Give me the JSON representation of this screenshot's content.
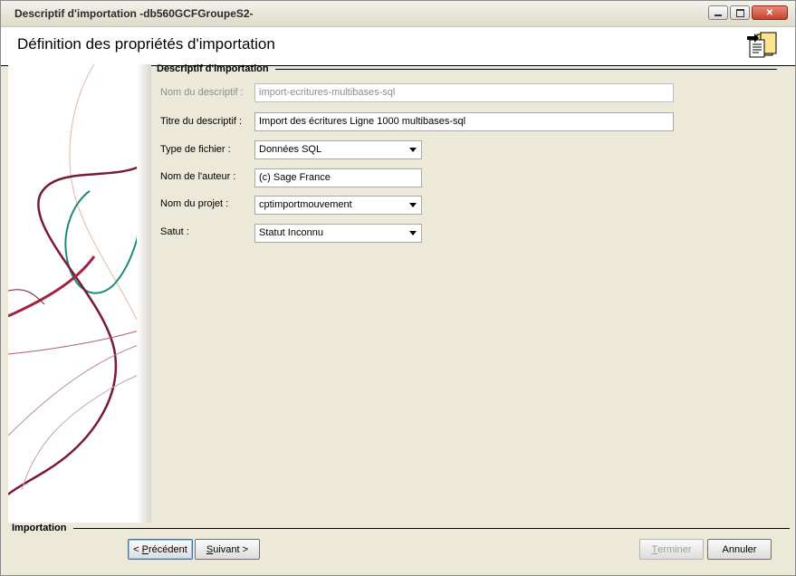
{
  "window": {
    "title": "Descriptif d'importation -db560GCFGroupeS2-"
  },
  "header": {
    "title": "Définition des propriétés d'importation"
  },
  "section": {
    "title": "Descriptif d'importation"
  },
  "form": {
    "nom_descriptif": {
      "label": "Nom du descriptif :",
      "value": "import-ecritures-multibases-sql"
    },
    "titre_descriptif": {
      "label": "Titre du descriptif :",
      "value": "Import des écritures Ligne 1000 multibases-sql"
    },
    "type_fichier": {
      "label": "Type de fichier :",
      "value": "Données SQL"
    },
    "nom_auteur": {
      "label": "Nom de l'auteur :",
      "value": "(c) Sage France"
    },
    "nom_projet": {
      "label": "Nom du projet :",
      "value": "cptimportmouvement"
    },
    "statut": {
      "label": "Satut :",
      "value": "Statut Inconnu"
    }
  },
  "footer": {
    "group_label": "Importation",
    "prev": {
      "pre": "< ",
      "accel": "P",
      "rest": "récédent"
    },
    "next": {
      "accel": "S",
      "rest": "uivant >"
    },
    "finish": {
      "accel": "T",
      "rest": "erminer"
    },
    "cancel": "Annuler"
  }
}
